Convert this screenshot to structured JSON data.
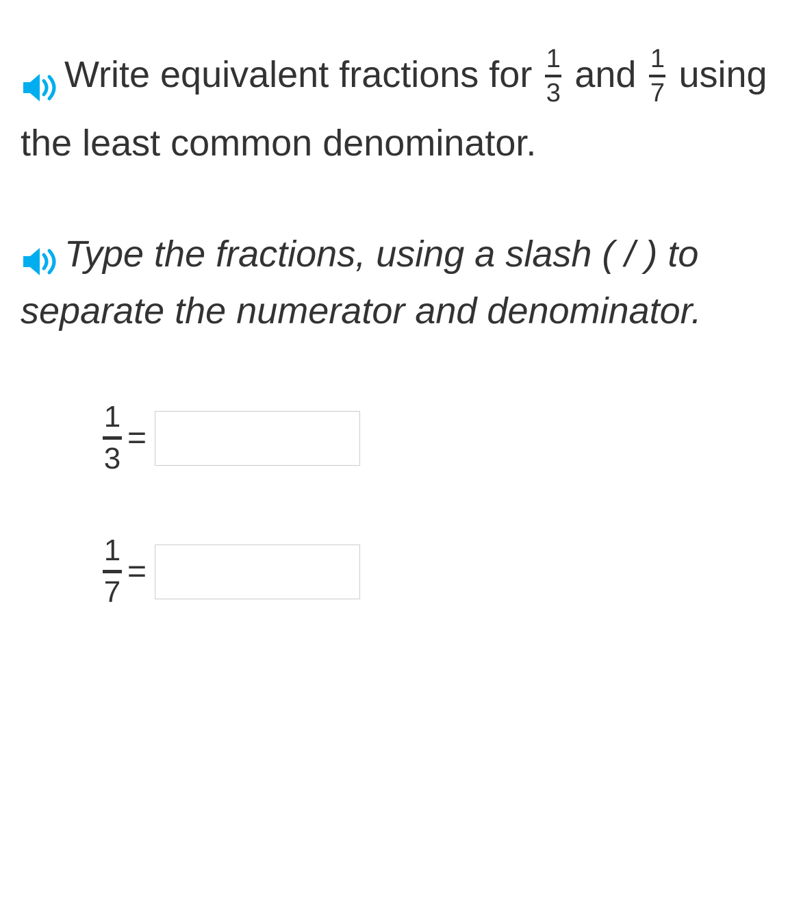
{
  "question": {
    "word_write": "Write",
    "text_part1": " equivalent fractions for ",
    "fraction1": {
      "numerator": "1",
      "denominator": "3"
    },
    "text_and": " and ",
    "fraction2": {
      "numerator": "1",
      "denominator": "7"
    },
    "text_part2": " using the least common denominator."
  },
  "instruction": {
    "text": "Type the fractions, using a slash ( / ) to separate the numerator and denominator."
  },
  "answers": [
    {
      "fraction": {
        "numerator": "1",
        "denominator": "3"
      },
      "equals": "=",
      "value": ""
    },
    {
      "fraction": {
        "numerator": "1",
        "denominator": "7"
      },
      "equals": "=",
      "value": ""
    }
  ],
  "colors": {
    "audio_icon": "#00AEEF",
    "text": "#333333",
    "input_border": "#cccccc"
  }
}
